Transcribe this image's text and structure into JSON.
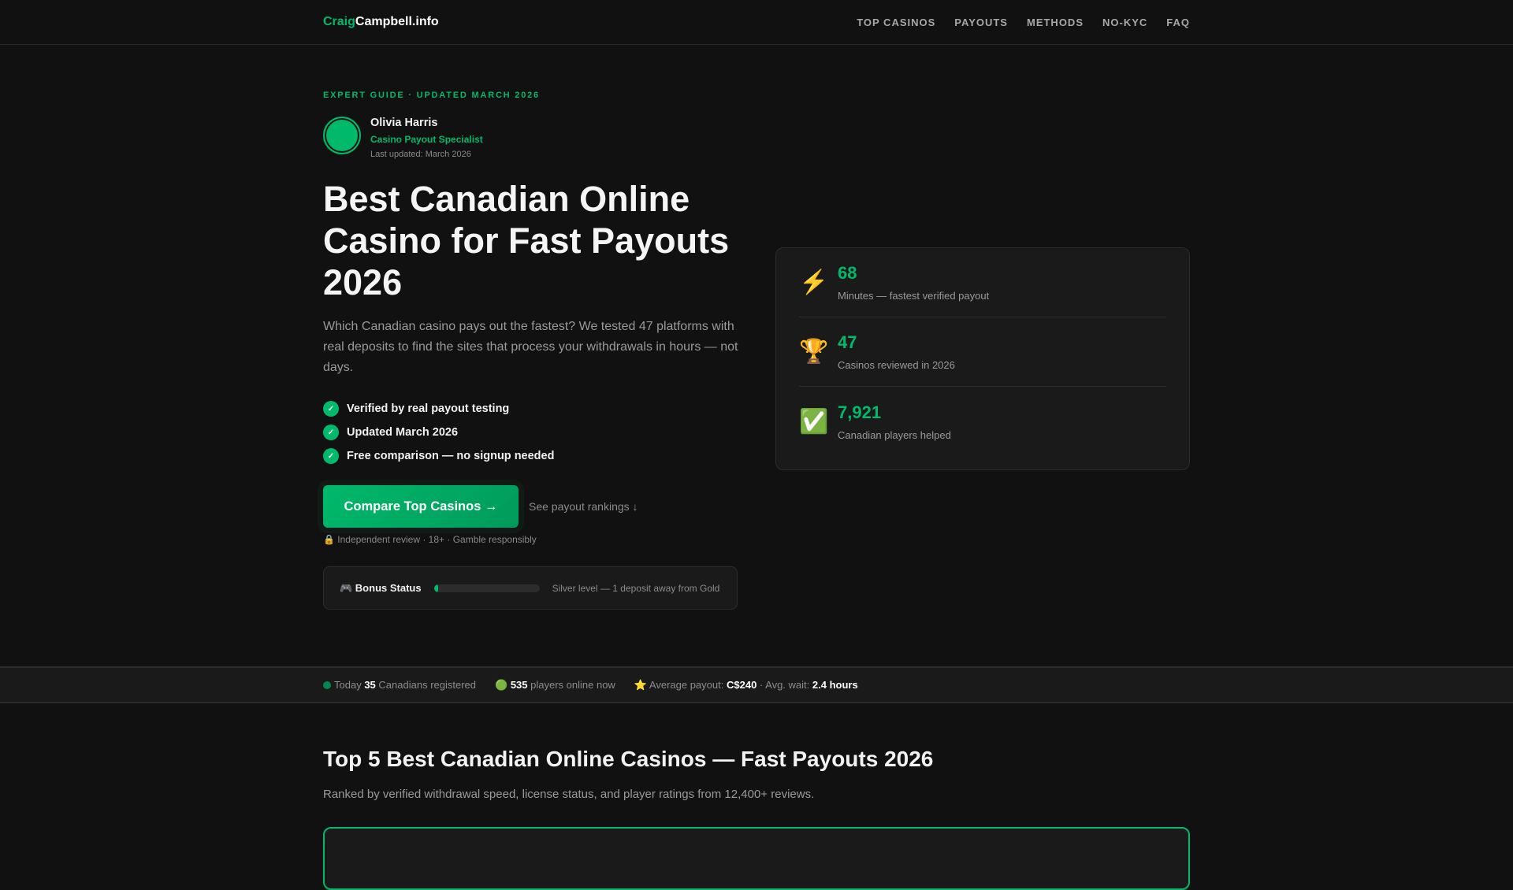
{
  "nav": {
    "logo_a": "Craig",
    "logo_b": "Campbell.info",
    "links": [
      "TOP CASINOS",
      "PAYOUTS",
      "METHODS",
      "NO-KYC",
      "FAQ"
    ]
  },
  "hero": {
    "eyebrow": "EXPERT GUIDE · UPDATED MARCH 2026",
    "author": {
      "name": "Olivia Harris",
      "role": "Casino Payout Specialist",
      "date": "Last updated: March 2026"
    },
    "title": "Best Canadian Online Casino for Fast Payouts 2026",
    "lead": "Which Canadian casino pays out the fastest? We tested 47 platforms with real deposits to find the sites that process your withdrawals in hours — not days.",
    "checks": [
      "Verified by real payout testing",
      "Updated March 2026",
      "Free comparison — no signup needed"
    ],
    "cta": "Compare Top Casinos →",
    "secondary": "See payout rankings ↓",
    "note": "🔒 Independent review · 18+ · Gamble responsibly",
    "bonus": {
      "label": "🎮 Bonus Status",
      "progress_percent": 4,
      "text": "Silver level — 1 deposit away from Gold"
    }
  },
  "stats": [
    {
      "icon": "⚡",
      "value": "68",
      "label": "Minutes — fastest verified payout"
    },
    {
      "icon": "🏆",
      "value": "47",
      "label": "Casinos reviewed in 2026"
    },
    {
      "icon": "✅",
      "value": "7,921",
      "label": "Canadian players helped"
    }
  ],
  "ticker": {
    "t1a": "Today",
    "t1b": "35",
    "t1c": "Canadians registered",
    "t2a": "🟢",
    "t2b": "535",
    "t2c": "players online now",
    "t3a": "⭐ Average payout:",
    "t3b": "C$240",
    "t3c": "· Avg. wait:",
    "t3d": "2.4 hours"
  },
  "section": {
    "title": "Top 5 Best Canadian Online Casinos — Fast Payouts 2026",
    "subtitle": "Ranked by verified withdrawal speed, license status, and player ratings from 12,400+ reviews."
  },
  "colors": {
    "accent": "#00b96b",
    "bg": "#111111",
    "card": "#1a1a1a"
  }
}
